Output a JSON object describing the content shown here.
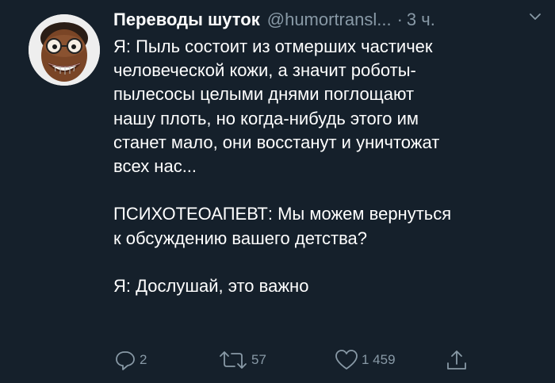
{
  "tweet": {
    "display_name": "Переводы шуток",
    "handle": "@humortransl...",
    "separator": "·",
    "time": "3 ч.",
    "paragraphs": [
      "Я: Пыль состоит из отмерших частичек\nчеловеческой кожи, а значит роботы-\nпылесосы целыми днями поглощают\nнашу плоть, но когда-нибудь этого им\nстанет мало, они восстанут и уничтожат\nвсех нас...",
      "ПСИХОТЕОАПЕВТ: Мы можем вернуться\nк обсуждению вашего детства?",
      "Я: Дослушай, это важно"
    ],
    "reply_count": "2",
    "retweet_count": "57",
    "like_count": "1 459"
  },
  "colors": {
    "background": "#15202b",
    "text": "#ffffff",
    "secondary": "#8899a6"
  },
  "icons": [
    "avatar",
    "chevron-down-icon",
    "reply-icon",
    "retweet-icon",
    "like-icon",
    "share-icon"
  ]
}
